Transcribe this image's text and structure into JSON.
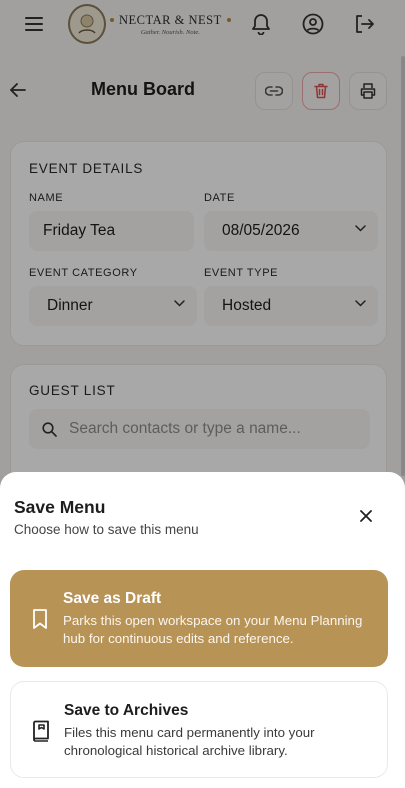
{
  "brand": {
    "name": "NECTAR & NEST",
    "tagline": "Gather. Nourish. Note."
  },
  "header": {
    "title": "Menu Board"
  },
  "event_details": {
    "section_title": "EVENT DETAILS",
    "name_label": "NAME",
    "name_value": "Friday Tea",
    "date_label": "DATE",
    "date_value": "08/05/2026",
    "category_label": "EVENT CATEGORY",
    "category_value": "Dinner",
    "type_label": "EVENT TYPE",
    "type_value": "Hosted"
  },
  "guest_list": {
    "section_title": "GUEST LIST",
    "search_placeholder": "Search contacts or type a name..."
  },
  "save_sheet": {
    "title": "Save Menu",
    "subtitle": "Choose how to save this menu",
    "draft_title": "Save as Draft",
    "draft_desc": "Parks this open workspace on your Menu Planning hub for continuous edits and reference.",
    "archive_title": "Save to Archives",
    "archive_desc": "Files this menu card permanently into your chronological historical archive library."
  },
  "colors": {
    "accent": "#b89356",
    "danger": "#d9534f",
    "overlay": "rgba(0,0,0,0.34)"
  },
  "icons": {
    "menu": "hamburger-icon",
    "notifications": "bell-icon",
    "profile": "user-circle-icon",
    "logout": "logout-icon",
    "back": "arrow-left-icon",
    "link": "link-icon",
    "delete": "trash-icon",
    "print": "printer-icon",
    "close": "close-icon",
    "draft": "bookmark-icon",
    "archive": "archive-book-icon"
  }
}
